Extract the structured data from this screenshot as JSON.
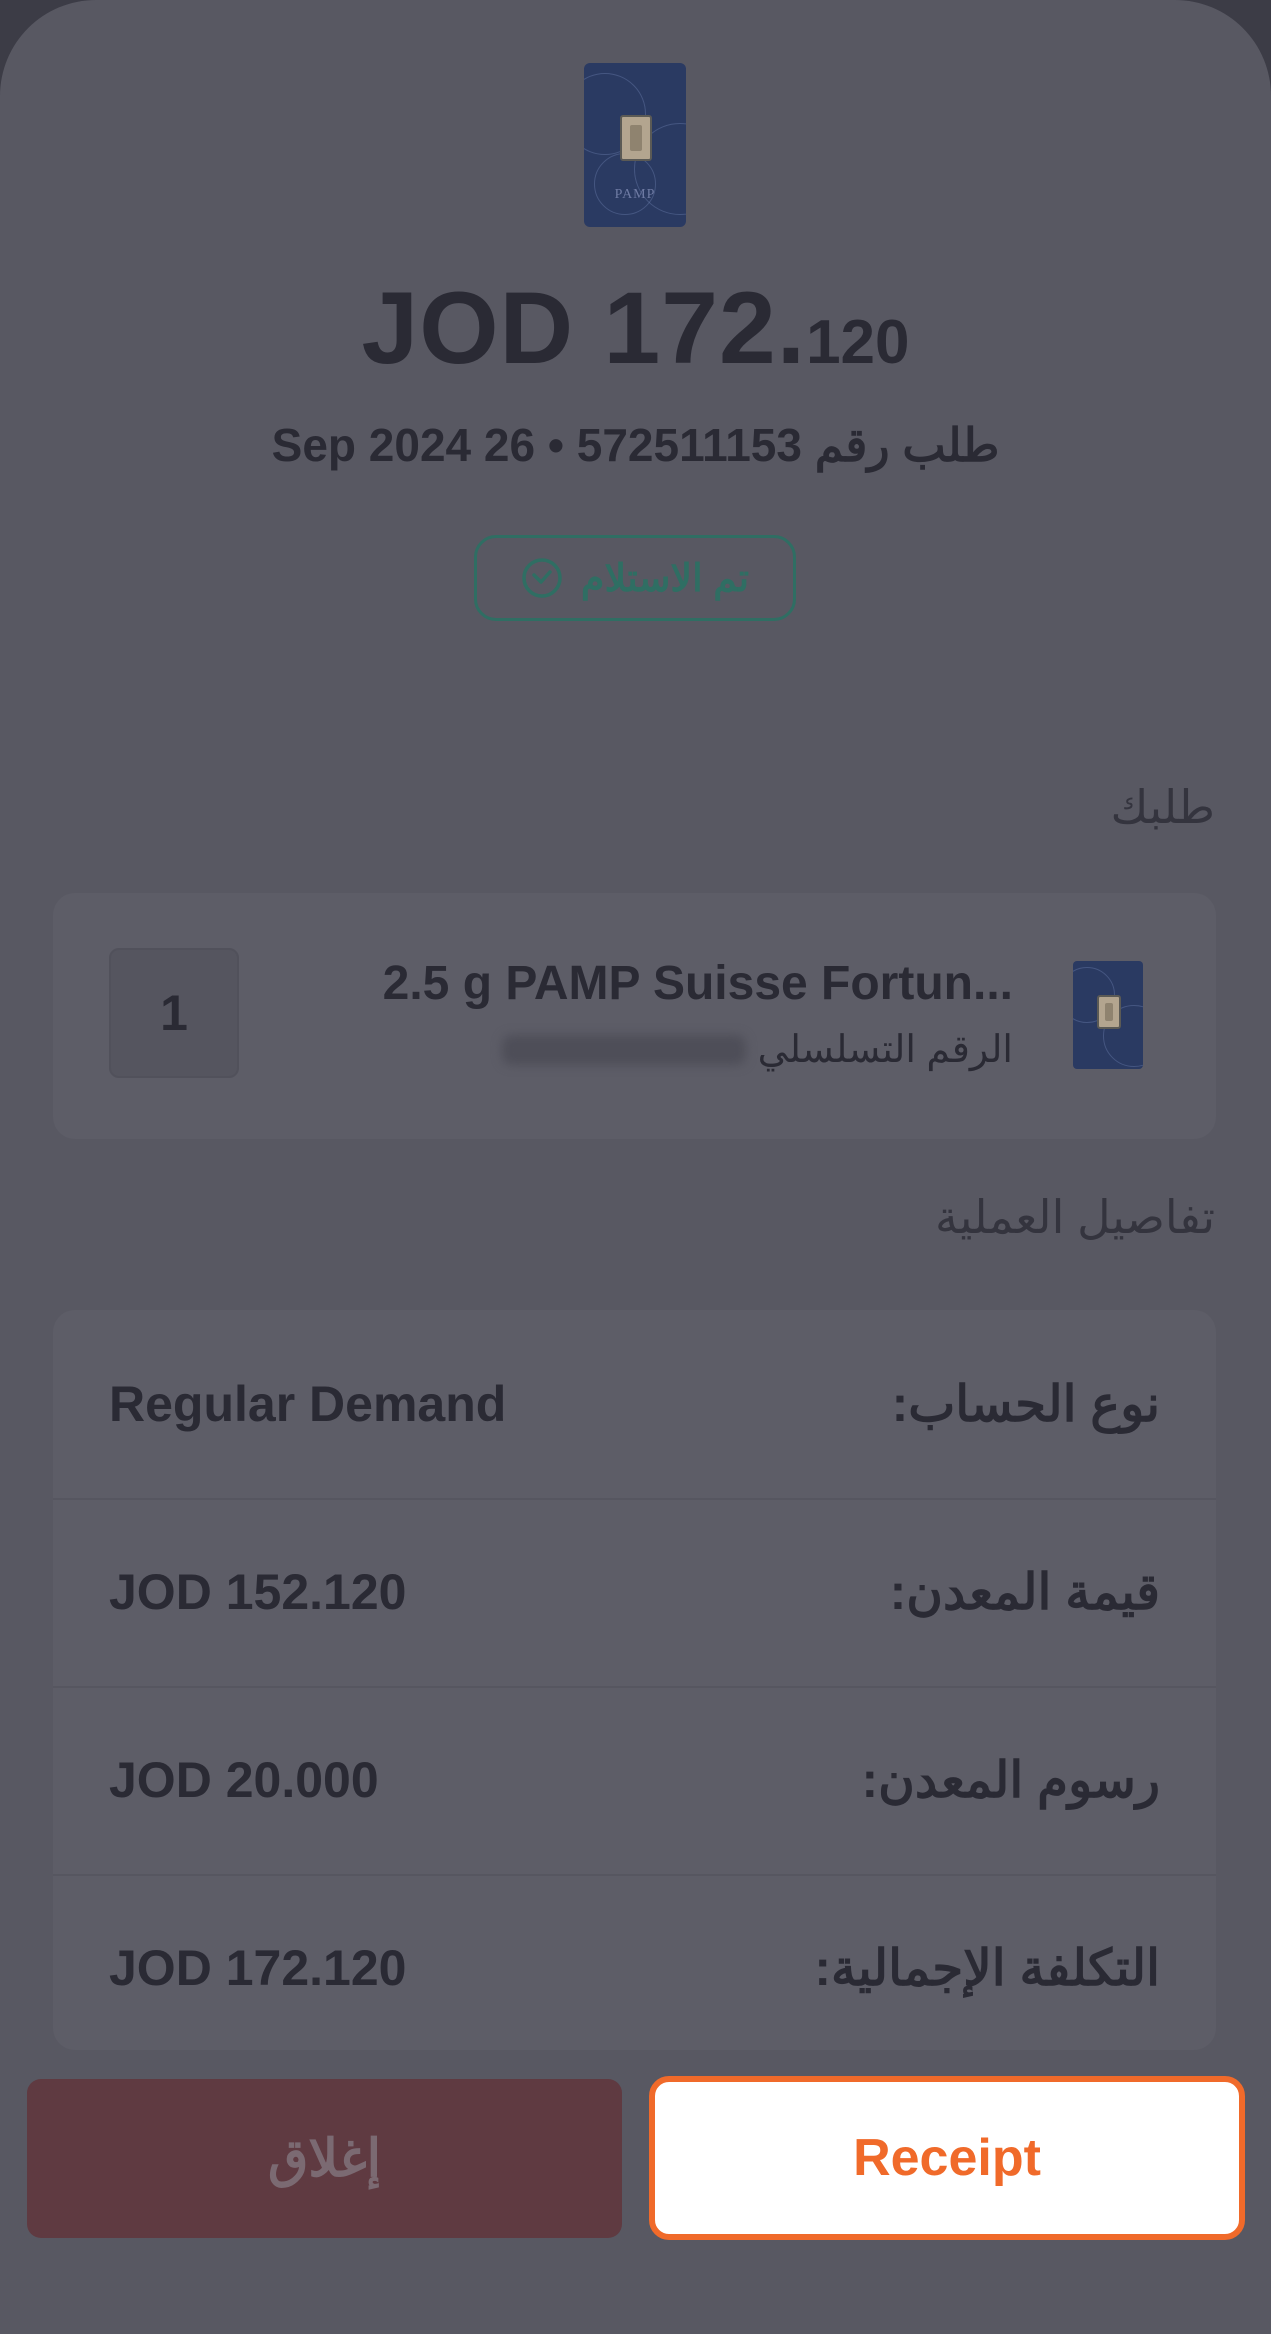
{
  "header": {
    "amount_main": "JOD 172.",
    "amount_fraction": "120",
    "order_line": "طلب رقم 572511153 • 26 Sep 2024",
    "status_label": "تم الاستلام"
  },
  "order_section": {
    "title": "طلبك",
    "item": {
      "name": "2.5 g PAMP Suisse Fortun...",
      "serial_label": "الرقم التسلسلي",
      "quantity": "1",
      "thumb_brand": "PAMP"
    }
  },
  "details_section": {
    "title": "تفاصيل العملية",
    "rows": [
      {
        "label": "نوع الحساب:",
        "value": "Regular Demand"
      },
      {
        "label": "قيمة المعدن:",
        "value": "JOD 152.120"
      },
      {
        "label": "رسوم المعدن:",
        "value": "JOD 20.000"
      },
      {
        "label": "التكلفة الإجمالية:",
        "value": "JOD 172.120"
      }
    ]
  },
  "actions": {
    "close_label": "إغلاق",
    "receipt_label": "Receipt"
  },
  "colors": {
    "accent": "#f06a2a",
    "status": "#2f6e63",
    "close_button": "#5f3a41"
  },
  "icons": {
    "status": "clock-check-icon",
    "product": "gold-bar-image"
  }
}
